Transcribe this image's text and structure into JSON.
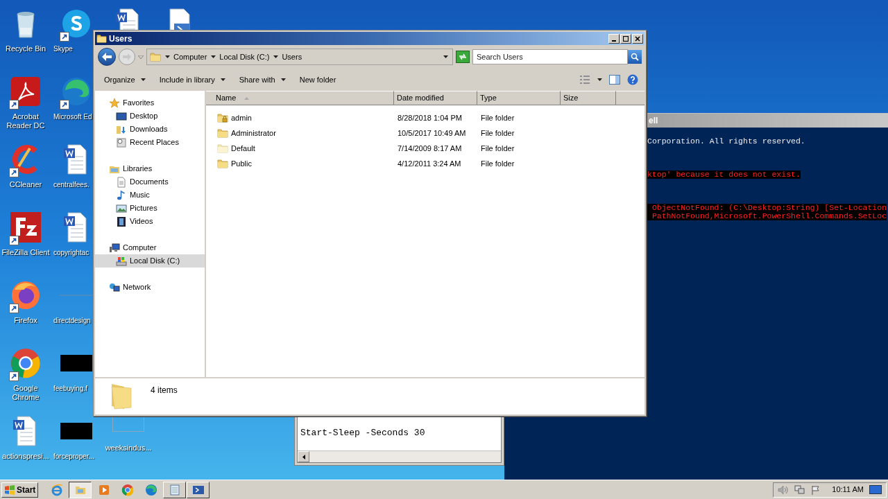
{
  "desktop": {
    "columns": [
      [
        {
          "kind": "recycle",
          "label": "Recycle Bin",
          "shortcut": false
        },
        {
          "kind": "acrobat",
          "label": "Acrobat Reader DC",
          "shortcut": true
        },
        {
          "kind": "ccleaner",
          "label": "CCleaner",
          "shortcut": true
        },
        {
          "kind": "filezilla",
          "label": "FileZilla Client",
          "shortcut": true
        },
        {
          "kind": "firefox",
          "label": "Firefox",
          "shortcut": true
        },
        {
          "kind": "chrome",
          "label": "Google Chrome",
          "shortcut": true
        },
        {
          "kind": "word",
          "label": "actionspresi...",
          "shortcut": false
        }
      ],
      [
        {
          "kind": "skype",
          "label": "Skype",
          "shortcut": true
        },
        {
          "kind": "edge",
          "label": "Microsoft Ed",
          "shortcut": true
        },
        {
          "kind": "word",
          "label": "centralfees.",
          "shortcut": false
        },
        {
          "kind": "word",
          "label": "copyrightac",
          "shortcut": false
        },
        {
          "kind": "line",
          "label": "directdesign",
          "shortcut": false
        },
        {
          "kind": "black",
          "label": "feebuying.f",
          "shortcut": false
        },
        {
          "kind": "black",
          "label": "forceproper...",
          "shortcut": false
        }
      ],
      [
        {
          "kind": "word",
          "shortcut": false
        },
        {
          "kind": "outline",
          "label": "weeksindus...",
          "shortcut": false
        }
      ],
      [
        {
          "kind": "script",
          "shortcut": false
        }
      ]
    ]
  },
  "powershell": {
    "title": "ell",
    "blocks": [
      [
        {
          "text": "Corporation. All rights reserved.",
          "kind": "normal"
        }
      ],
      [
        {
          "text": "ktop' because it does not exist.",
          "kind": "error"
        }
      ],
      [
        {
          "text": " ObjectNotFound: (C:\\Desktop:String) [Set-Location",
          "kind": "error"
        },
        {
          "text": " PathNotFound,Microsoft.PowerShell.Commands.SetLoc",
          "kind": "error"
        }
      ]
    ]
  },
  "editor": {
    "lines": [
      "Start-Sleep -Seconds 30"
    ]
  },
  "explorer": {
    "title": "Users",
    "breadcrumb": [
      "Computer",
      "Local Disk (C:)",
      "Users"
    ],
    "search": {
      "placeholder": "Search Users"
    },
    "toolbar": [
      {
        "label": "Organize",
        "dropdown": true
      },
      {
        "label": "Include in library",
        "dropdown": true
      },
      {
        "label": "Share with",
        "dropdown": true
      },
      {
        "label": "New folder",
        "dropdown": false
      }
    ],
    "navigation": [
      {
        "label": "Favorites",
        "kind": "star",
        "selected": false,
        "children": [
          {
            "label": "Desktop",
            "kind": "desktop",
            "selected": false
          },
          {
            "label": "Downloads",
            "kind": "downloads",
            "selected": false
          },
          {
            "label": "Recent Places",
            "kind": "recent",
            "selected": false
          }
        ]
      },
      {
        "label": "Libraries",
        "kind": "libraries",
        "selected": false,
        "children": [
          {
            "label": "Documents",
            "kind": "document",
            "selected": false
          },
          {
            "label": "Music",
            "kind": "music",
            "selected": false
          },
          {
            "label": "Pictures",
            "kind": "pictures",
            "selected": false
          },
          {
            "label": "Videos",
            "kind": "videos",
            "selected": false
          }
        ]
      },
      {
        "label": "Computer",
        "kind": "computer",
        "selected": false,
        "children": [
          {
            "label": "Local Disk (C:)",
            "kind": "disk",
            "selected": true
          }
        ]
      },
      {
        "label": "Network",
        "kind": "network",
        "selected": false
      }
    ],
    "columns": [
      {
        "label": "Name",
        "sorted": true
      },
      {
        "label": "Date modified",
        "sorted": false
      },
      {
        "label": "Type",
        "sorted": false
      },
      {
        "label": "Size",
        "sorted": false
      }
    ],
    "rows": [
      {
        "kind": "locked",
        "name": "admin",
        "date_modified": "8/28/2018 1:04 PM",
        "type": "File folder"
      },
      {
        "kind": "folder",
        "name": "Administrator",
        "date_modified": "10/5/2017 10:49 AM",
        "type": "File folder"
      },
      {
        "kind": "hidden",
        "name": "Default",
        "date_modified": "7/14/2009 8:17 AM",
        "type": "File folder"
      },
      {
        "kind": "folder",
        "name": "Public",
        "date_modified": "4/12/2011 3:24 AM",
        "type": "File folder"
      }
    ],
    "status": "4 items"
  },
  "taskbar": {
    "start": "Start",
    "apps": [
      {
        "kind": "ie",
        "active": false
      },
      {
        "kind": "explorer",
        "active": true
      },
      {
        "kind": "media",
        "active": false
      },
      {
        "kind": "chrome",
        "active": false
      },
      {
        "kind": "edge",
        "active": false
      },
      {
        "kind": "notepad",
        "active": false
      },
      {
        "kind": "powershell",
        "active": false
      }
    ],
    "clock": "10:11 AM"
  }
}
